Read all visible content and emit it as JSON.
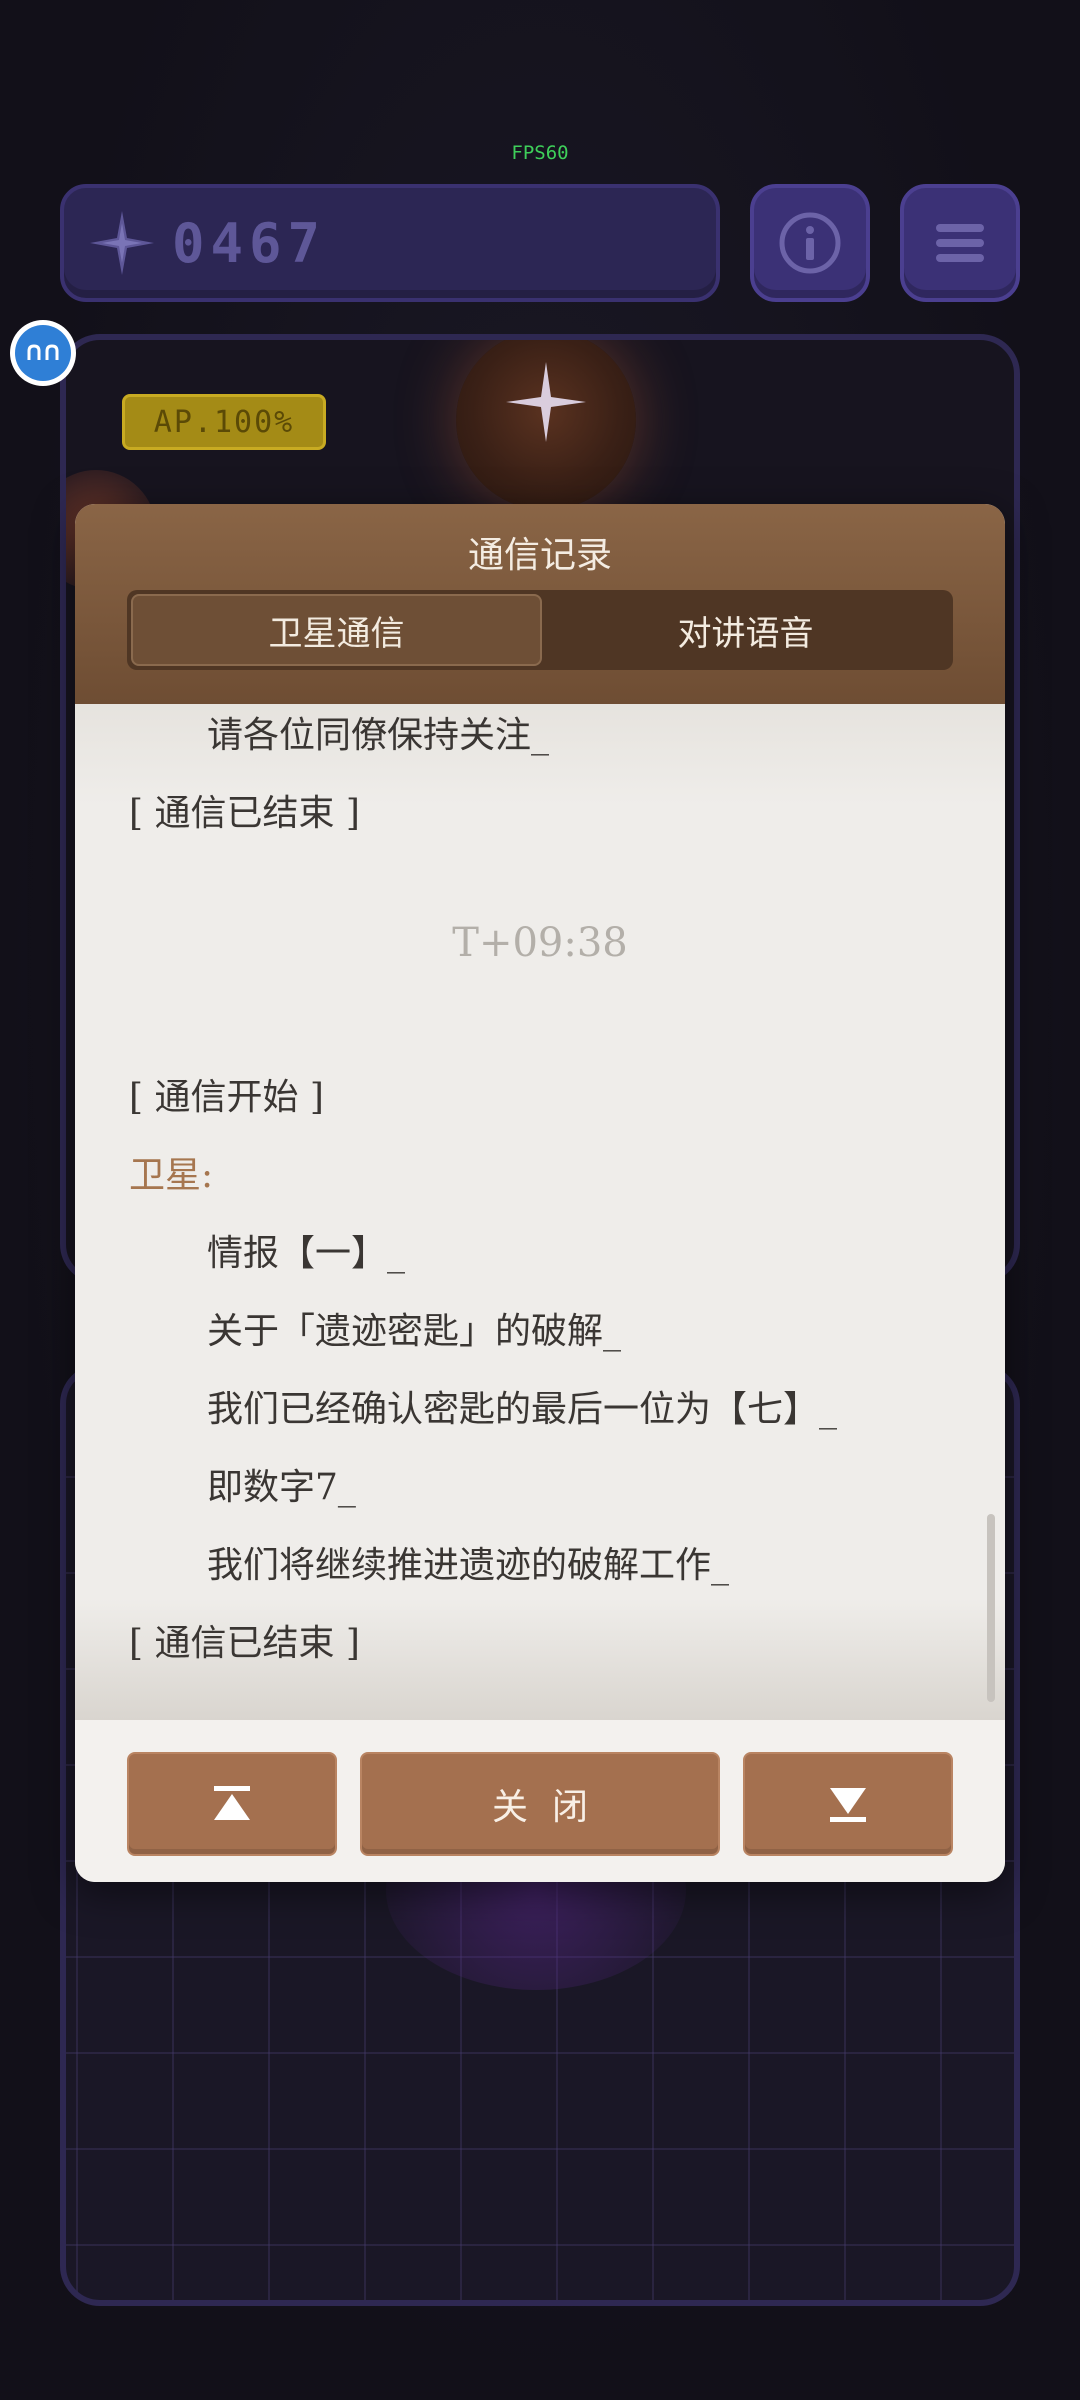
{
  "hud": {
    "fps_label": "FPS60",
    "score": "0467",
    "ap_badge": "AP.100%"
  },
  "icons": {
    "score": "compass-star-icon",
    "info": "info-icon",
    "menu": "menu-icon",
    "floating": "assistant-bubble-icon",
    "scroll_top": "scroll-to-top-icon",
    "scroll_bottom": "scroll-to-bottom-icon"
  },
  "modal": {
    "title": "通信记录",
    "tabs": [
      {
        "label": "卫星通信",
        "active": true
      },
      {
        "label": "对讲语音",
        "active": false
      }
    ],
    "log": [
      {
        "text": "请各位同僚保持关注_",
        "style": "indent"
      },
      {
        "text": "[ 通信已结束 ]",
        "style": "plain"
      },
      {
        "text": "T+09:38",
        "style": "time"
      },
      {
        "text": "[ 通信开始 ]",
        "style": "plain"
      },
      {
        "text": "卫星:",
        "style": "speaker"
      },
      {
        "text": "情报【一】_",
        "style": "indent"
      },
      {
        "text": "关于「遗迹密匙」的破解_",
        "style": "indent"
      },
      {
        "text": "我们已经确认密匙的最后一位为【七】_",
        "style": "indent"
      },
      {
        "text": "即数字7_",
        "style": "indent"
      },
      {
        "text": "我们将继续推进遗迹的破解工作_",
        "style": "indent"
      },
      {
        "text": "[ 通信已结束 ]",
        "style": "plain"
      }
    ],
    "close_label": "关闭"
  },
  "colors": {
    "header": "#7b5a3e",
    "button": "#a4704f",
    "speaker": "#a6764f",
    "panel_border": "#2e2852"
  }
}
